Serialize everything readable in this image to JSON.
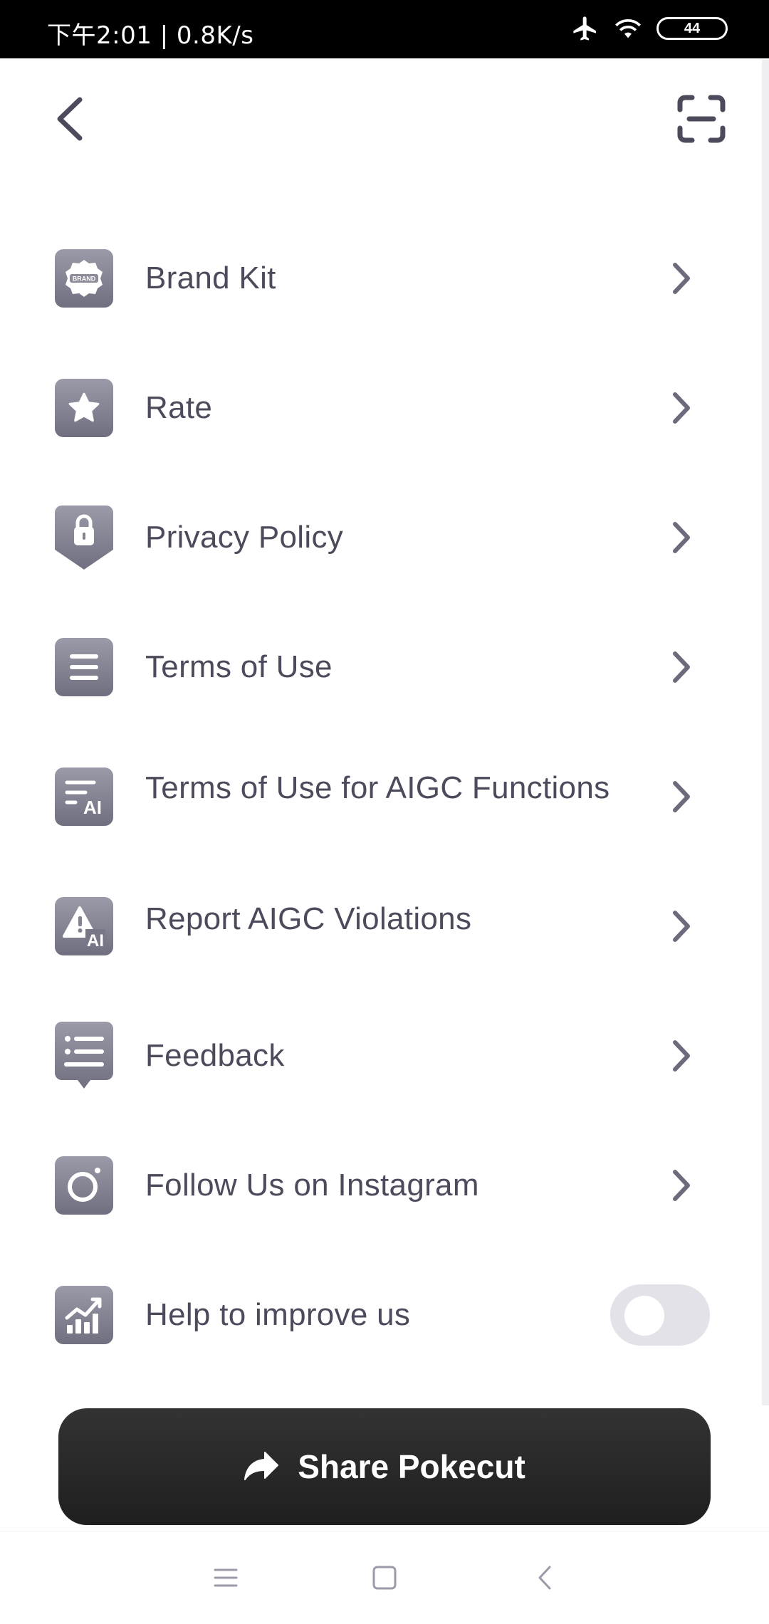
{
  "status_bar": {
    "time_text": "下午2:01 | 0.8K/s",
    "battery": "44",
    "icons": [
      "airplane-icon",
      "wifi-icon",
      "battery-icon"
    ]
  },
  "header": {
    "back_icon": "chevron-left-icon",
    "scan_icon": "scan-icon"
  },
  "menu": {
    "items": [
      {
        "label": "Brand Kit",
        "icon": "brand-badge-icon"
      },
      {
        "label": "Rate",
        "icon": "star-icon"
      },
      {
        "label": "Privacy Policy",
        "icon": "lock-shield-icon"
      },
      {
        "label": "Terms of Use",
        "icon": "document-lines-icon"
      },
      {
        "label": "Terms of Use for AIGC Functions",
        "icon": "ai-document-icon"
      },
      {
        "label": "Report AIGC Violations",
        "icon": "ai-warning-icon"
      },
      {
        "label": "Feedback",
        "icon": "feedback-list-icon"
      },
      {
        "label": "Follow Us on Instagram",
        "icon": "instagram-icon"
      }
    ],
    "improve": {
      "label": "Help to improve us",
      "icon": "chart-icon",
      "enabled": false
    }
  },
  "share_button": {
    "label": "Share Pokecut",
    "icon": "share-arrow-icon"
  },
  "nav_bar": {
    "icons": [
      "menu-icon",
      "home-square-icon",
      "back-triangle-icon"
    ]
  },
  "colors": {
    "accent": "#2a2a2a",
    "icon_bg": "#82828f",
    "text": "#4b4b5c"
  }
}
